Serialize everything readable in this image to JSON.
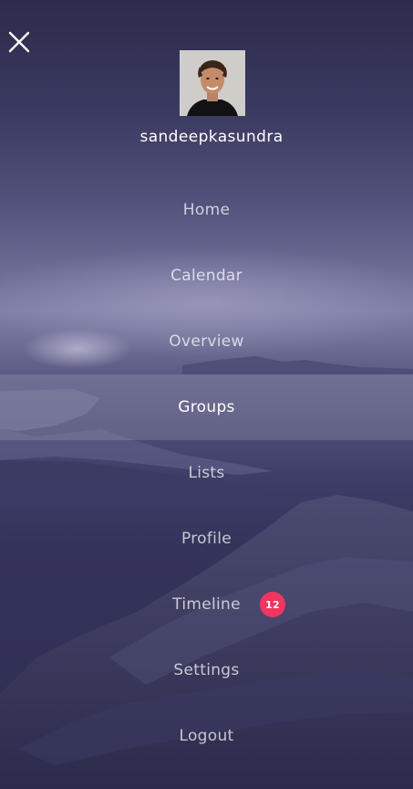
{
  "user": {
    "username": "sandeepkasundra"
  },
  "menu": {
    "items": [
      {
        "label": "Home"
      },
      {
        "label": "Calendar"
      },
      {
        "label": "Overview"
      },
      {
        "label": "Groups",
        "active": true
      },
      {
        "label": "Lists"
      },
      {
        "label": "Profile"
      },
      {
        "label": "Timeline",
        "badge": "12"
      },
      {
        "label": "Settings"
      },
      {
        "label": "Logout"
      }
    ]
  },
  "colors": {
    "background": "#2e2d52",
    "badge": "#f0365e",
    "active_highlight": "rgba(255,255,255,0.13)",
    "text": "#ffffff"
  },
  "icons": {
    "close": "close-icon"
  }
}
